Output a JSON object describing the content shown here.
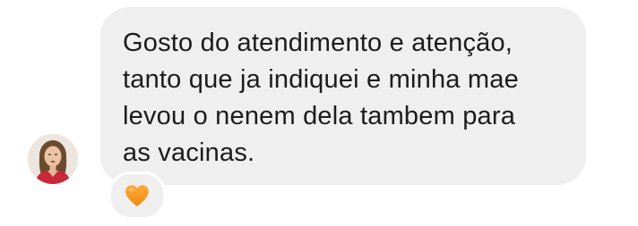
{
  "message": {
    "text": "Gosto do atendimento e atenção,\ntanto que ja indiquei e minha mae\nlevou o nenem dela tambem para\nas vacinas."
  },
  "sender": {
    "avatar_icon": "user-avatar-photo"
  },
  "reaction": {
    "icon": "orange-heart-icon",
    "color": "#f5921b"
  },
  "colors": {
    "bubble_bg": "#efefef",
    "text": "#1c1c1c",
    "background": "#ffffff"
  }
}
